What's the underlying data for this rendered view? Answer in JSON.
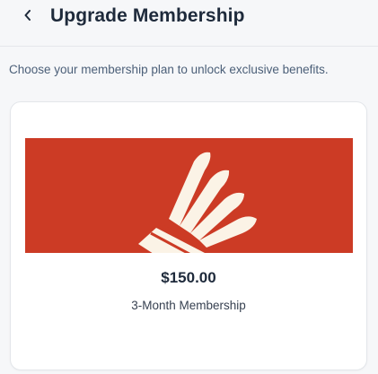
{
  "header": {
    "back_icon": "chevron-left-icon",
    "title": "Upgrade Membership"
  },
  "intro": {
    "text": "Choose your membership plan to unlock exclusive benefits."
  },
  "plans": [
    {
      "image_icon": "shuttlecock-icon",
      "banner_color": "#cc3b25",
      "price": "$150.00",
      "name": "3-Month Membership"
    }
  ],
  "colors": {
    "accent": "#cc3b25",
    "shuttlecock": "#fbf3e6",
    "title_text": "#1e2a3b"
  }
}
